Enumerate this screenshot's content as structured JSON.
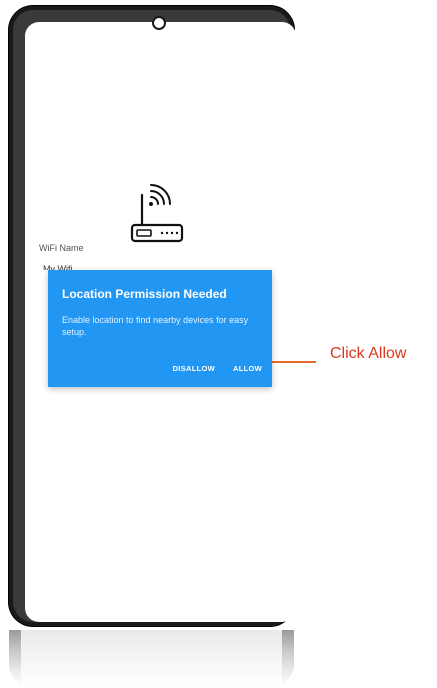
{
  "screen": {
    "wifi_label": "WiFi Name",
    "wifi_value": "My Wifi"
  },
  "dialog": {
    "title": "Location Permission Needed",
    "message": "Enable location to find nearby devices for easy setup.",
    "disallow_label": "DISALLOW",
    "allow_label": "ALLOW",
    "background_color": "#2196F3"
  },
  "annotation": {
    "text": "Click Allow",
    "color": "#d9381e"
  },
  "icons": {
    "router": "wifi-router-icon"
  }
}
